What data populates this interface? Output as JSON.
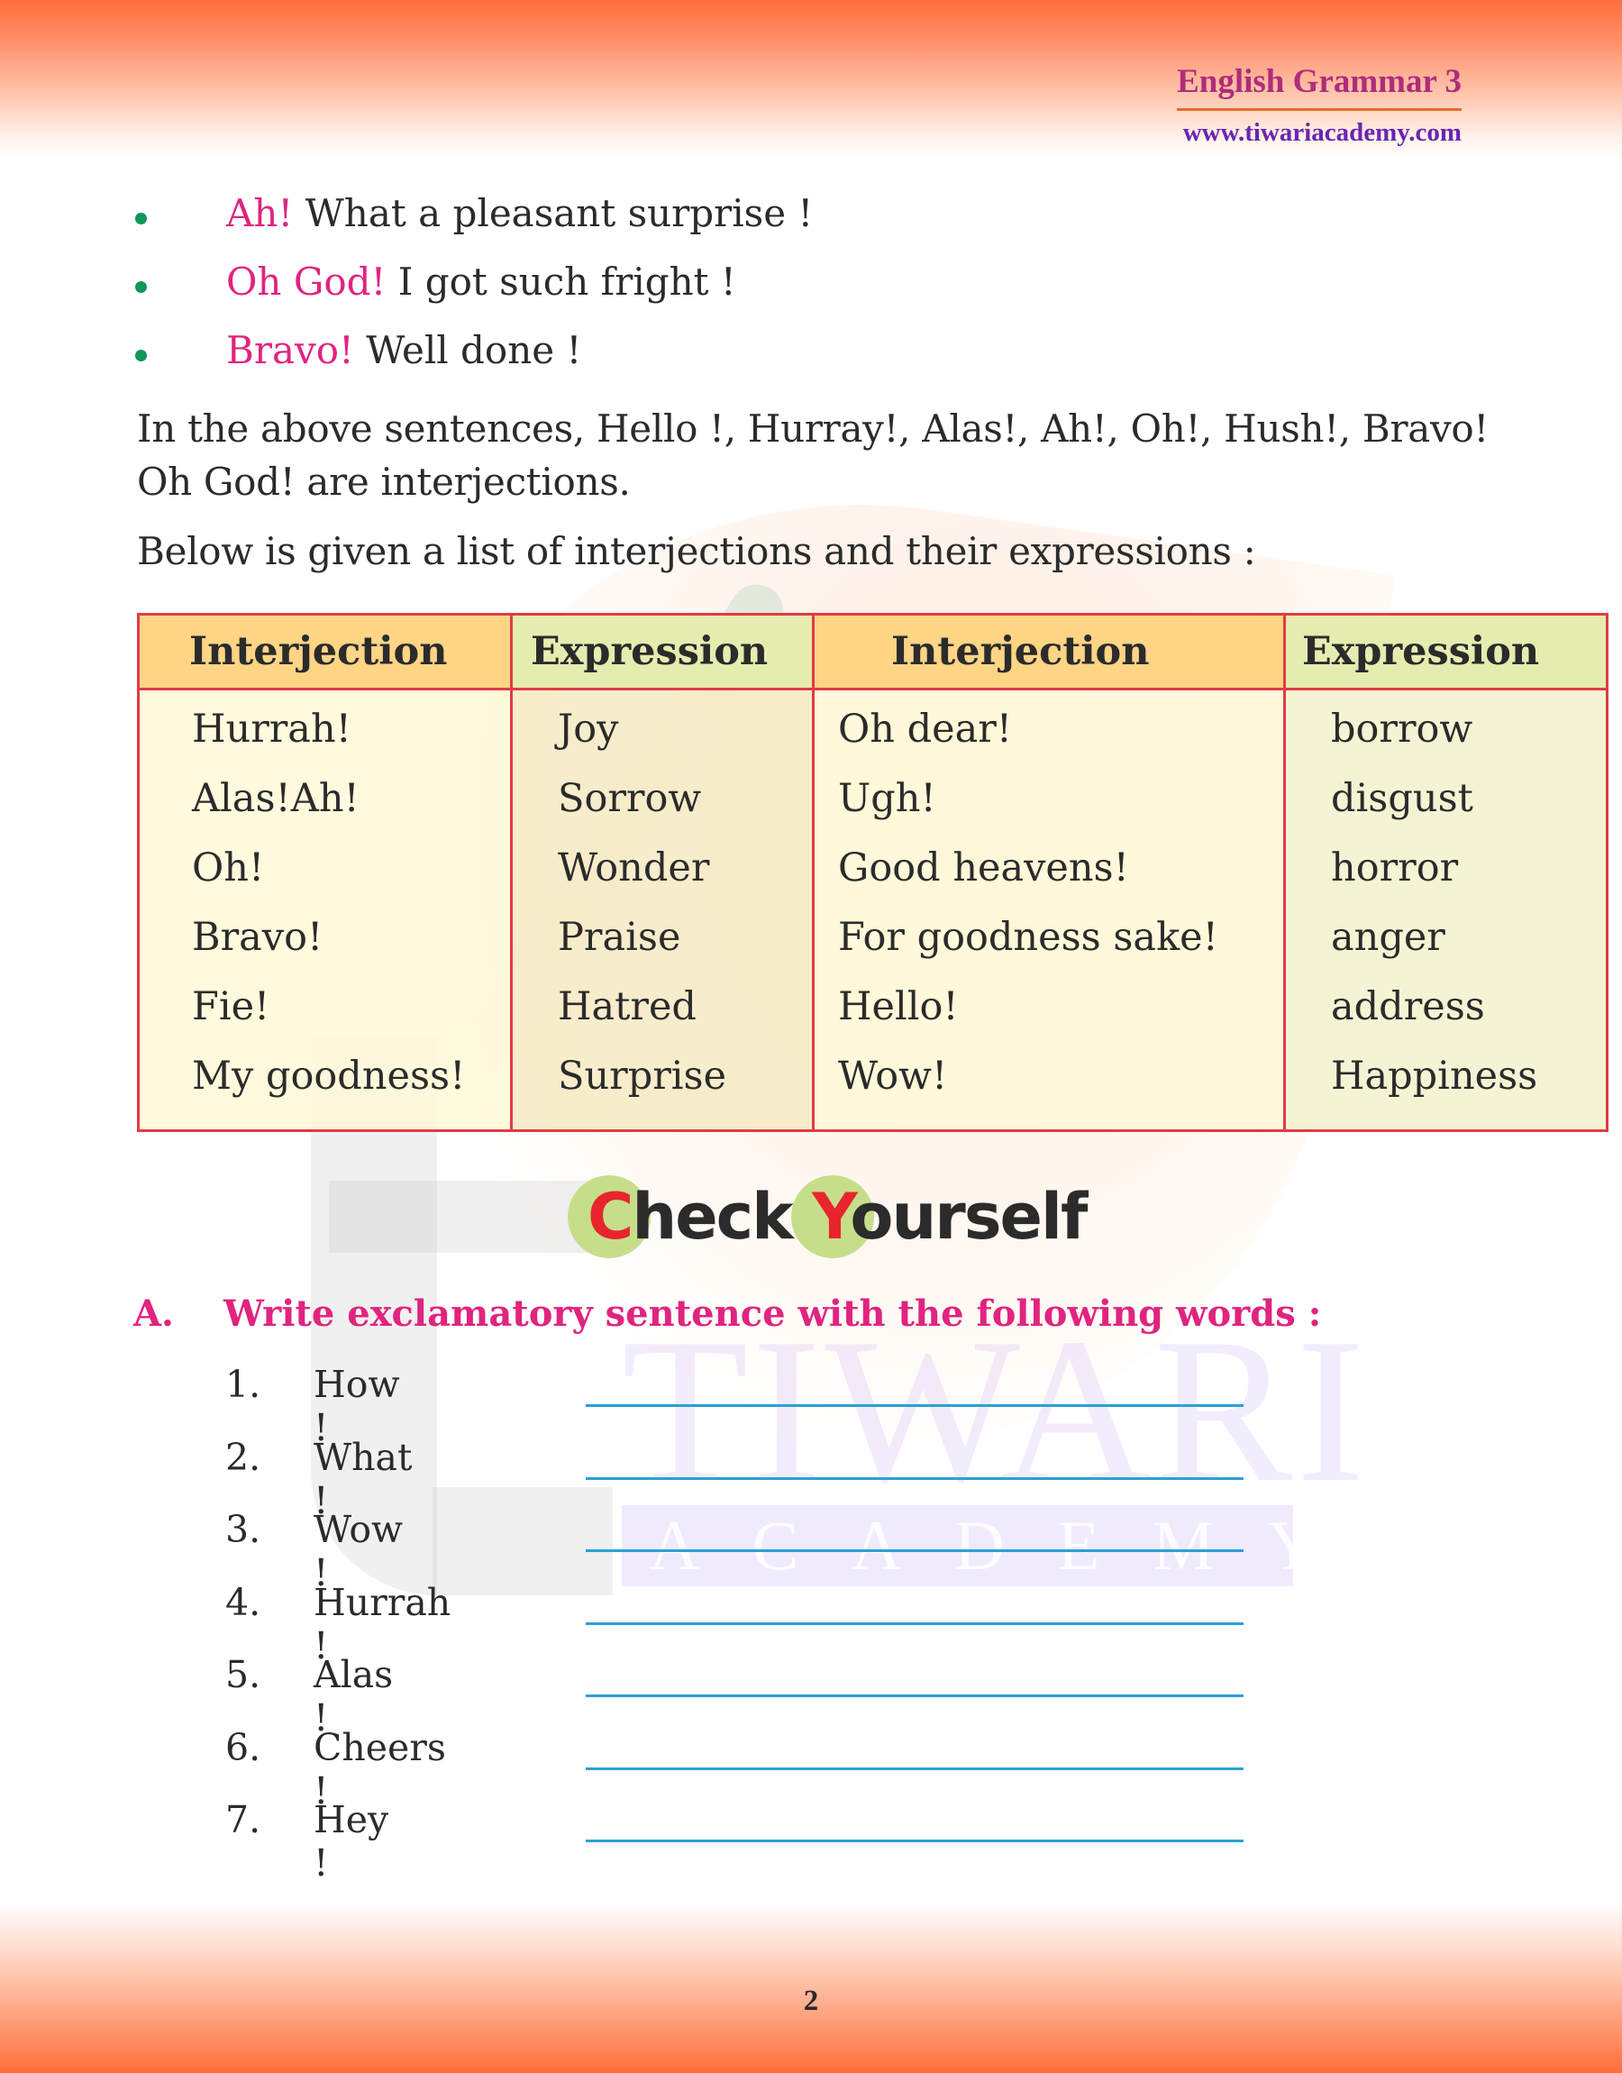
{
  "header": {
    "title": "English Grammar 3",
    "url": "www.tiwariacademy.com"
  },
  "watermark": {
    "word1": "TIWARI",
    "word2": "ACADEMY"
  },
  "bullets": [
    {
      "highlight": "Ah!",
      "text": " What a pleasant surprise !"
    },
    {
      "highlight": "Oh God!",
      "text": " I got such fright !"
    },
    {
      "highlight": "Bravo!",
      "text": " Well done !"
    }
  ],
  "paragraphs": {
    "p1": "In the above sentences, Hello !, Hurray!, Alas!, Ah!, Oh!, Hush!, Bravo! Oh God! are interjections.",
    "p2": "Below is given a list of interjections and their expressions :"
  },
  "table": {
    "headers": [
      "Interjection",
      "Expression",
      "Interjection",
      "Expression"
    ],
    "rows": [
      [
        "Hurrah!",
        "Joy",
        "Oh dear!",
        "borrow"
      ],
      [
        "Alas!Ah!",
        "Sorrow",
        "Ugh!",
        "disgust"
      ],
      [
        "Oh!",
        "Wonder",
        "Good heavens!",
        "horror"
      ],
      [
        "Bravo!",
        "Praise",
        "For goodness sake!",
        "anger"
      ],
      [
        "Fie!",
        "Hatred",
        "Hello!",
        "address"
      ],
      [
        "My goodness!",
        "Surprise",
        "Wow!",
        "Happiness"
      ]
    ]
  },
  "check_yourself": {
    "c": "C",
    "heck": "heck ",
    "y": "Y",
    "ourself": "ourself"
  },
  "exercise": {
    "label": "A.",
    "instruction": "Write exclamatory sentence with the following words :",
    "items": [
      {
        "num": "1.",
        "word": "How !",
        "answer": ""
      },
      {
        "num": "2.",
        "word": "What !",
        "answer": ""
      },
      {
        "num": "3.",
        "word": "Wow !",
        "answer": ""
      },
      {
        "num": "4.",
        "word": "Hurrah !",
        "answer": ""
      },
      {
        "num": "5.",
        "word": "Alas !",
        "answer": ""
      },
      {
        "num": "6.",
        "word": "Cheers !",
        "answer": ""
      },
      {
        "num": "7.",
        "word": "Hey !",
        "answer": ""
      }
    ]
  },
  "page_number": "2",
  "colors": {
    "accent_pink": "#e0247f",
    "title_purple": "#b02c7a",
    "url_violet": "#6a25b3",
    "bullet_green": "#10965a",
    "table_border": "#e03c44",
    "answer_line": "#2aa0d8",
    "band_orange": "#ff6d3b"
  }
}
